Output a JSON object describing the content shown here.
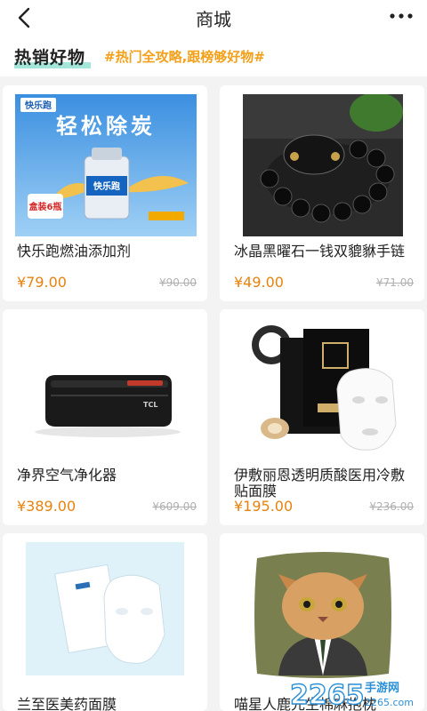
{
  "header": {
    "title": "商城"
  },
  "hot_section": {
    "title": "热销好物",
    "subtitle": "#热门全攻略,跟榜够好物#"
  },
  "products": [
    {
      "name": "快乐跑燃油添加剂",
      "price": "¥79.00",
      "original_price": "¥90.00",
      "img_banner": "轻松除炭",
      "img_brand": "快乐跑",
      "img_badge": "盒装6瓶"
    },
    {
      "name": "冰晶黑曜石一钱双貔貅手链",
      "price": "¥49.00",
      "original_price": "¥71.00"
    },
    {
      "name": "净界空气净化器",
      "price": "¥389.00",
      "original_price": "¥609.00",
      "img_brand": "TCL"
    },
    {
      "name": "伊敷丽恩透明质酸医用冷敷贴面膜",
      "price": "¥195.00",
      "original_price": "¥236.00"
    },
    {
      "name": "兰至医美药面膜",
      "price": "",
      "original_price": ""
    },
    {
      "name": "喵星人鹿先生棉麻抱枕",
      "price": "",
      "original_price": ""
    }
  ],
  "watermark": {
    "logo": "2265",
    "suffix": "手游网",
    "domain": "2265.com"
  }
}
